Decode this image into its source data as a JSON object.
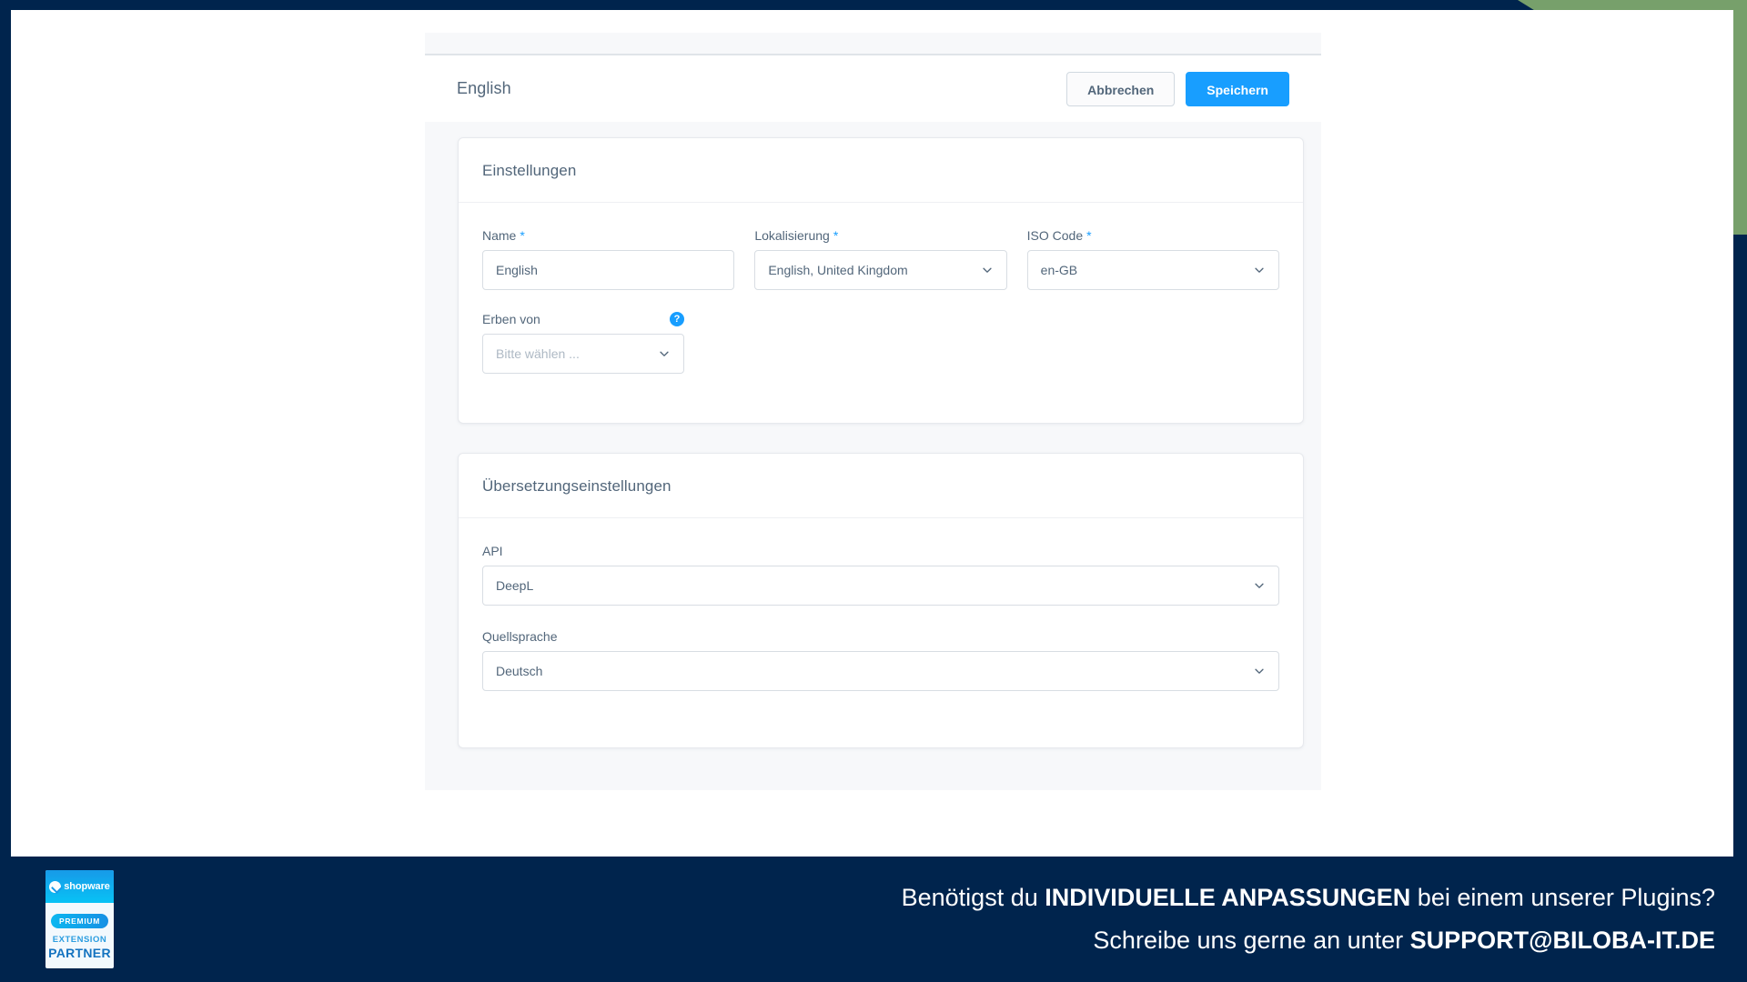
{
  "theme": {
    "frame_navy": "#00244d",
    "accent_green": "#77a06b",
    "primary_blue": "#189eff",
    "text_muted": "#52667a",
    "page_bg": "#f7f8fa"
  },
  "smart_bar": {
    "title": "English",
    "cancel_label": "Abbrechen",
    "save_label": "Speichern"
  },
  "settings_card": {
    "title": "Einstellungen",
    "fields": {
      "name": {
        "label": "Name",
        "required_marker": "*",
        "value": "English"
      },
      "localization": {
        "label": "Lokalisierung",
        "required_marker": "*",
        "value": "English, United Kingdom",
        "chevron_icon": "chevron-down-icon"
      },
      "iso_code": {
        "label": "ISO Code",
        "required_marker": "*",
        "value": "en-GB",
        "chevron_icon": "chevron-down-icon"
      },
      "inherit_from": {
        "label": "Erben von",
        "help_icon": "help-circle-icon",
        "help_glyph": "?",
        "placeholder": "Bitte wählen ...",
        "value": "",
        "chevron_icon": "chevron-down-icon"
      }
    }
  },
  "translation_card": {
    "title": "Übersetzungseinstellungen",
    "fields": {
      "api": {
        "label": "API",
        "value": "DeepL",
        "chevron_icon": "chevron-down-icon"
      },
      "source_language": {
        "label": "Quellsprache",
        "value": "Deutsch",
        "chevron_icon": "chevron-down-icon"
      }
    }
  },
  "footer": {
    "badge": {
      "brand": "shopware",
      "brand_mark_icon": "shopware-logo-icon",
      "premium": "PREMIUM",
      "extension": "EXTENSION",
      "partner": "PARTNER"
    },
    "line1_pre": "Benötigst du ",
    "line1_bold": "INDIVIDUELLE ANPASSUNGEN",
    "line1_post": " bei einem unserer Plugins?",
    "line2_pre": "Schreibe uns gerne an unter ",
    "line2_bold": "SUPPORT@BILOBA-IT.DE"
  }
}
